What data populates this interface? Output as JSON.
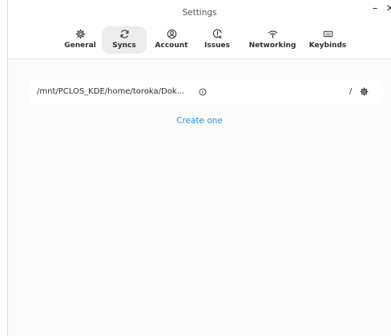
{
  "window": {
    "title": "Settings",
    "minimize_label": "–",
    "close_label": "×"
  },
  "tabs": [
    {
      "label": "General",
      "icon": "gear-icon",
      "active": false
    },
    {
      "label": "Syncs",
      "icon": "sync-icon",
      "active": true
    },
    {
      "label": "Account",
      "icon": "account-icon",
      "active": false
    },
    {
      "label": "Issues",
      "icon": "issues-icon",
      "active": false
    },
    {
      "label": "Networking",
      "icon": "wifi-icon",
      "active": false
    },
    {
      "label": "Keybinds",
      "icon": "keyboard-icon",
      "active": false
    }
  ],
  "sync": {
    "path": "/mnt/PCLOS_KDE/home/toroka/Dok...",
    "info_icon": "info-icon",
    "remote": "/",
    "settings_icon": "gear-icon"
  },
  "create_link": "Create one",
  "colors": {
    "accent": "#2b8fd6",
    "active_tab": "#ececec",
    "background": "#fbfbfb"
  }
}
